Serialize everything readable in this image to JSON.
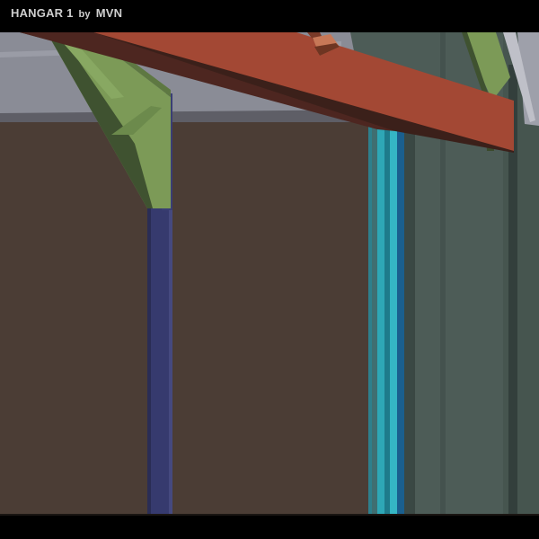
{
  "window": {
    "title_main": "HANGAR 1",
    "title_by": "by",
    "title_author": "MVN"
  },
  "scene": {
    "description_colors": {
      "ceiling": "#8a8c96",
      "back_wall": "#4b3d35",
      "side_wall": "#4d5c57",
      "side_wall_dark": "#3f4c48",
      "beam_top": "#a34834",
      "beam_bottom": "#3b201a",
      "truss": "#7c9a57",
      "truss_dark": "#3f5230",
      "column_blue": "#363a6e",
      "column_cyan": "#2ea7b6",
      "lamp": "#b0684a"
    }
  }
}
